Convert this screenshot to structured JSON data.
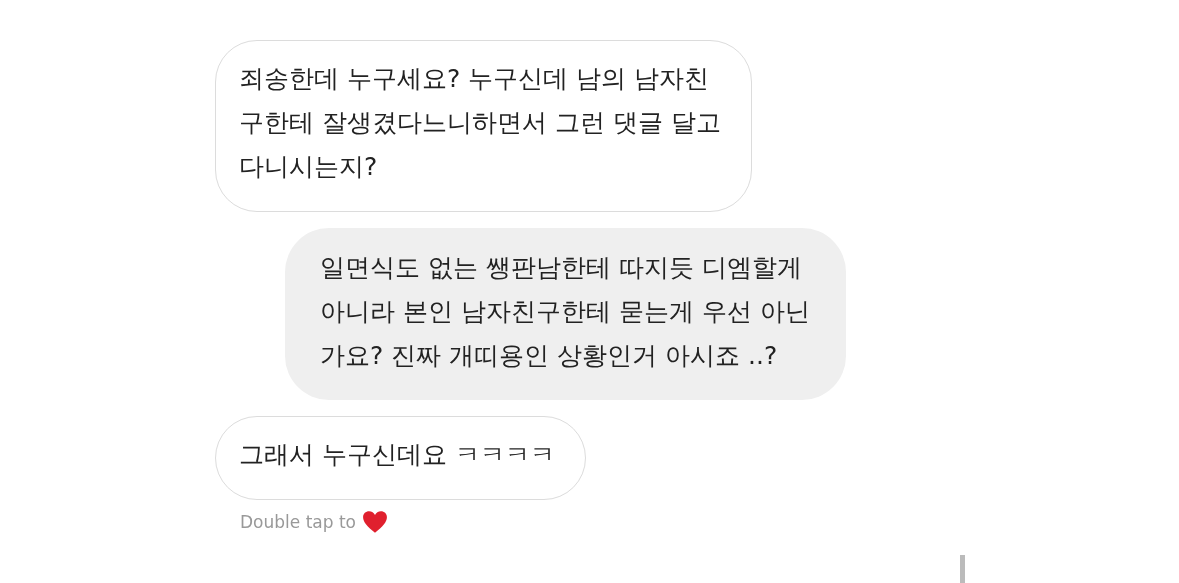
{
  "messages": [
    {
      "kind": "received",
      "text": "죄송한데 누구세요? 누구신데 남의 남자친\n구한테 잘생겼다느니하면서 그런 댓글 달고\n다니시는지?"
    },
    {
      "kind": "sent",
      "text": "일면식도 없는 쌩판남한테 따지듯 디엠할게\n아니라 본인 남자친구한테 묻는게 우선 아닌\n가요? 진짜 개띠용인 상황인거 아시죠 ..?"
    },
    {
      "kind": "received",
      "text": "그래서 누구신데요 ㅋㅋㅋㅋ"
    }
  ],
  "hint": "Double tap to"
}
